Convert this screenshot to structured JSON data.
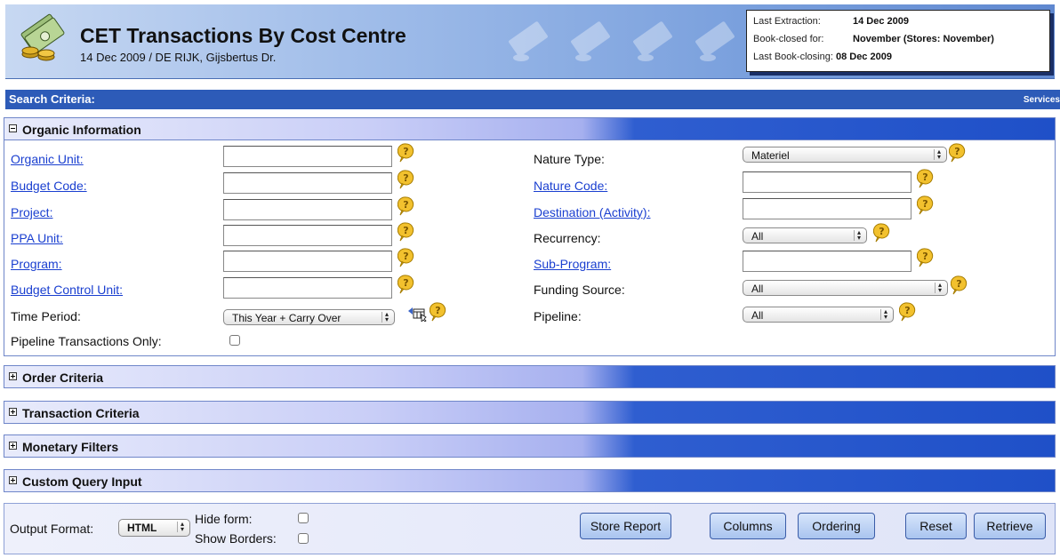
{
  "header": {
    "title": "CET Transactions By Cost Centre",
    "subtitle": "14 Dec 2009 / DE RIJK, Gijsbertus Dr.",
    "info": {
      "last_extraction_label": "Last Extraction:",
      "last_extraction_value": "14 Dec 2009",
      "book_closed_label": "Book-closed for:",
      "book_closed_value": "November (Stores: November)",
      "last_book_closing_label": "Last Book-closing:",
      "last_book_closing_value": "08 Dec 2009"
    }
  },
  "search": {
    "title": "Search Criteria:",
    "services": "Services"
  },
  "sections": {
    "organic": "Organic Information",
    "order": "Order Criteria",
    "transaction": "Transaction Criteria",
    "monetary": "Monetary Filters",
    "custom": "Custom Query Input"
  },
  "form": {
    "organic_unit": "Organic Unit:",
    "budget_code": "Budget Code:",
    "project": "Project:",
    "ppa_unit": "PPA Unit:",
    "program": "Program:",
    "budget_control_unit": "Budget Control Unit:",
    "time_period": "Time Period:",
    "time_period_value": "This Year + Carry Over",
    "pipeline_only": "Pipeline Transactions Only:",
    "nature_type": "Nature Type:",
    "nature_type_value": "Materiel",
    "nature_code": "Nature Code:",
    "destination": "Destination (Activity):",
    "recurrency": "Recurrency:",
    "recurrency_value": "All",
    "sub_program": "Sub-Program:",
    "funding_source": "Funding Source:",
    "funding_source_value": "All",
    "pipeline": "Pipeline:",
    "pipeline_value": "All"
  },
  "bottom": {
    "output_format": "Output Format:",
    "output_format_value": "HTML",
    "hide_form": "Hide form:",
    "show_borders": "Show Borders:",
    "store_report": "Store Report",
    "columns": "Columns",
    "ordering": "Ordering",
    "reset": "Reset",
    "retrieve": "Retrieve"
  },
  "colors": {
    "link": "#1a3fd0",
    "bar": "#2d5bb8",
    "help_icon": "#f2c12e"
  },
  "icons": [
    "money-logo-icon",
    "help-icon",
    "calendar-picker-icon",
    "plus-icon",
    "minus-icon"
  ]
}
